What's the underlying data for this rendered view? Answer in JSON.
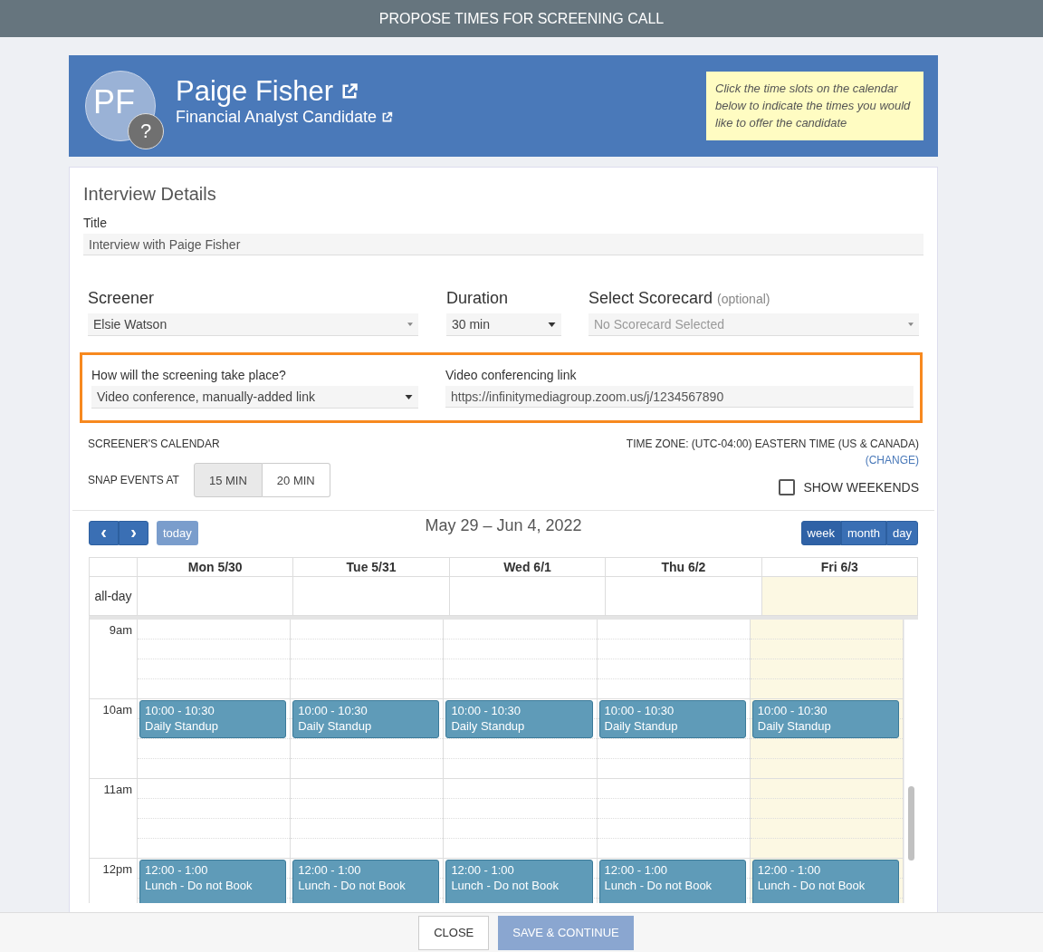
{
  "window": {
    "title": "PROPOSE TIMES FOR SCREENING CALL"
  },
  "candidate": {
    "initials": "PF",
    "badge": "?",
    "name": "Paige Fisher",
    "role": "Financial Analyst Candidate",
    "hint": "Click the time slots on the calendar below to indicate the times you would like to offer the candidate"
  },
  "details": {
    "heading": "Interview Details",
    "title_label": "Title",
    "title_value": "Interview with Paige Fisher",
    "screener": {
      "label": "Screener",
      "value": "Elsie Watson"
    },
    "duration": {
      "label": "Duration",
      "value": "30 min"
    },
    "scorecard": {
      "label": "Select Scorecard",
      "note": "(optional)",
      "placeholder": "No Scorecard Selected"
    },
    "method": {
      "label": "How will the screening take place?",
      "value": "Video conference, manually-added link"
    },
    "link": {
      "label": "Video conferencing link",
      "value": "https://infinitymediagroup.zoom.us/j/1234567890"
    }
  },
  "calendar": {
    "label": "SCREENER'S CALENDAR",
    "timezone": "TIME ZONE: (UTC-04:00) EASTERN TIME (US & CANADA)",
    "change": "(CHANGE)",
    "snap_label": "SNAP EVENTS AT",
    "snap_options": [
      {
        "label": "15 MIN",
        "selected": true
      },
      {
        "label": "20 MIN",
        "selected": false
      }
    ],
    "weekends": {
      "label": "SHOW WEEKENDS",
      "checked": false
    },
    "prev": "‹",
    "next": "›",
    "today": "today",
    "range": "May 29 – Jun 4, 2022",
    "views": [
      {
        "label": "week",
        "selected": true
      },
      {
        "label": "month",
        "selected": false
      },
      {
        "label": "day",
        "selected": false
      }
    ],
    "allday": "all-day",
    "days": [
      {
        "label": "Mon 5/30",
        "today": false
      },
      {
        "label": "Tue 5/31",
        "today": false
      },
      {
        "label": "Wed 6/1",
        "today": false
      },
      {
        "label": "Thu 6/2",
        "today": false
      },
      {
        "label": "Fri 6/3",
        "today": true
      }
    ],
    "hours": [
      {
        "label": "9am"
      },
      {
        "label": "10am",
        "events": [
          {
            "kind": "half",
            "time": "10:00 - 10:30",
            "title": "Daily Standup"
          },
          {
            "kind": "half",
            "time": "10:00 - 10:30",
            "title": "Daily Standup"
          },
          {
            "kind": "half",
            "time": "10:00 - 10:30",
            "title": "Daily Standup"
          },
          {
            "kind": "half",
            "time": "10:00 - 10:30",
            "title": "Daily Standup"
          },
          {
            "kind": "half",
            "time": "10:00 - 10:30",
            "title": "Daily Standup"
          }
        ]
      },
      {
        "label": "11am"
      },
      {
        "label": "12pm",
        "events": [
          {
            "kind": "hour",
            "time": "12:00 - 1:00",
            "title": "Lunch - Do not Book"
          },
          {
            "kind": "hour",
            "time": "12:00 - 1:00",
            "title": "Lunch - Do not Book"
          },
          {
            "kind": "hour",
            "time": "12:00 - 1:00",
            "title": "Lunch - Do not Book"
          },
          {
            "kind": "hour",
            "time": "12:00 - 1:00",
            "title": "Lunch - Do not Book"
          },
          {
            "kind": "hour",
            "time": "12:00 - 1:00",
            "title": "Lunch - Do not Book"
          }
        ]
      }
    ]
  },
  "footer": {
    "close": "CLOSE",
    "save": {
      "label": "SAVE & CONTINUE",
      "disabled": true
    }
  }
}
